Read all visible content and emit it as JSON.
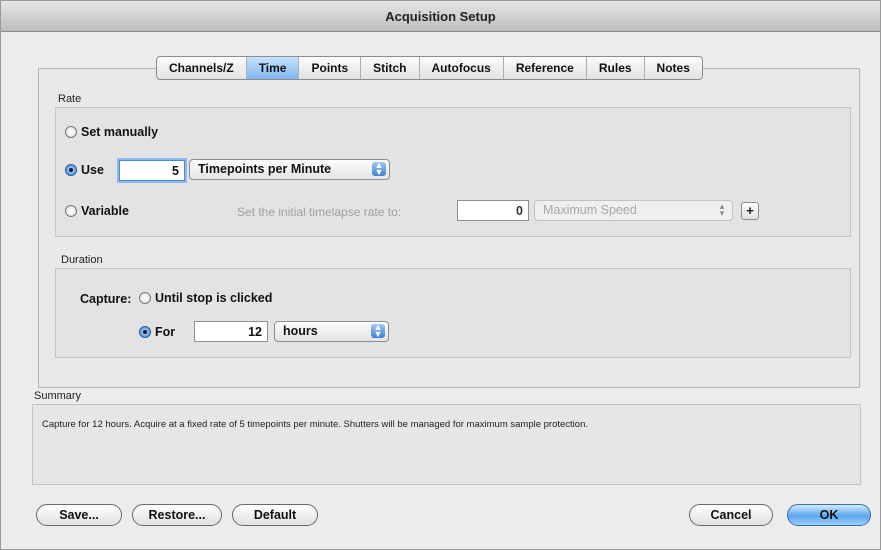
{
  "window": {
    "title": "Acquisition Setup"
  },
  "tabs": [
    {
      "label": "Channels/Z",
      "active": false
    },
    {
      "label": "Time",
      "active": true
    },
    {
      "label": "Points",
      "active": false
    },
    {
      "label": "Stitch",
      "active": false
    },
    {
      "label": "Autofocus",
      "active": false
    },
    {
      "label": "Reference",
      "active": false
    },
    {
      "label": "Rules",
      "active": false
    },
    {
      "label": "Notes",
      "active": false
    }
  ],
  "rate": {
    "label": "Rate",
    "set_manually": "Set manually",
    "use_label": "Use",
    "use_value": "5",
    "use_unit": "Timepoints per Minute",
    "variable_label": "Variable",
    "initial_rate_label": "Set the initial timelapse rate to:",
    "initial_rate_value": "0",
    "initial_rate_unit": "Maximum Speed",
    "plus": "+",
    "selected": "use"
  },
  "duration": {
    "label": "Duration",
    "capture_label": "Capture:",
    "until_stop": "Until stop is clicked",
    "for_label": "For",
    "for_value": "12",
    "for_unit": "hours",
    "selected": "for"
  },
  "summary": {
    "label": "Summary",
    "text": "Capture for 12 hours.  Acquire at a fixed rate of 5 timepoints per minute.  Shutters will be managed for maximum sample protection."
  },
  "buttons": {
    "save": "Save...",
    "restore": "Restore...",
    "default": "Default",
    "cancel": "Cancel",
    "ok": "OK"
  },
  "colors": {
    "accent": "#5ba6ee",
    "active_tab": "#7fb7ef"
  },
  "icons": {
    "popup_arrows": "up-down-arrows-icon"
  }
}
